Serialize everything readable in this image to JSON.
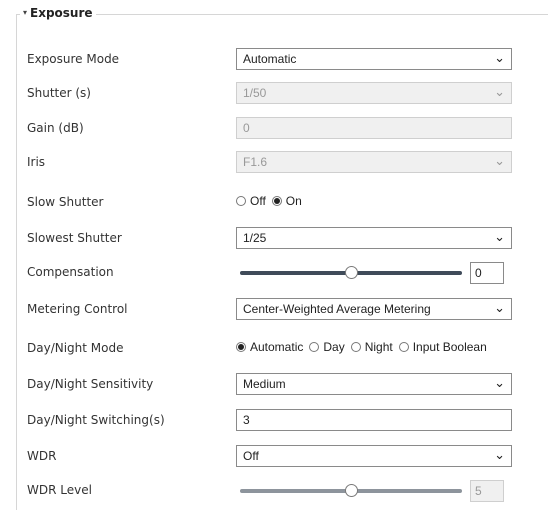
{
  "section": {
    "title": "Exposure"
  },
  "fields": {
    "exposure_mode": {
      "label": "Exposure Mode",
      "value": "Automatic"
    },
    "shutter": {
      "label": "Shutter (s)",
      "value": "1/50"
    },
    "gain": {
      "label": "Gain (dB)",
      "value": "0"
    },
    "iris": {
      "label": "Iris",
      "value": "F1.6"
    },
    "slow_shutter": {
      "label": "Slow Shutter",
      "options": [
        "Off",
        "On"
      ],
      "selected": "On"
    },
    "slowest_shutter": {
      "label": "Slowest Shutter",
      "value": "1/25"
    },
    "compensation": {
      "label": "Compensation",
      "value": "0",
      "level": 0.5
    },
    "metering_control": {
      "label": "Metering Control",
      "value": "Center-Weighted Average Metering"
    },
    "day_night_mode": {
      "label": "Day/Night Mode",
      "options": [
        "Automatic",
        "Day",
        "Night",
        "Input Boolean"
      ],
      "selected": "Automatic"
    },
    "day_night_sensitivity": {
      "label": "Day/Night Sensitivity",
      "value": "Medium"
    },
    "day_night_switching": {
      "label": "Day/Night Switching(s)",
      "value": "3"
    },
    "wdr": {
      "label": "WDR",
      "value": "Off"
    },
    "wdr_level": {
      "label": "WDR Level",
      "value": "5",
      "level": 0.5
    }
  },
  "icons": {
    "dropdown": "chevron-down-icon",
    "collapse": "caret-down-icon"
  }
}
